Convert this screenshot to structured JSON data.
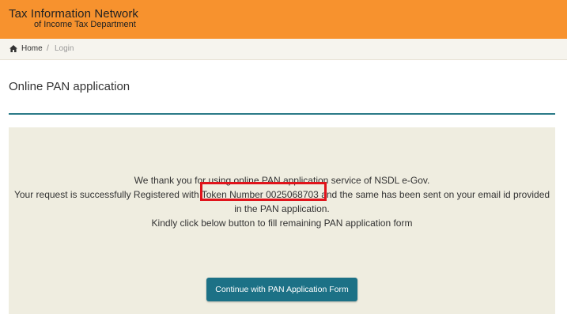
{
  "header": {
    "title": "Tax Information Network",
    "subtitle": "of Income Tax Department",
    "bg_color": "#f7922e"
  },
  "breadcrumb": {
    "home_icon": "home-icon",
    "home_label": "Home",
    "separator": "/",
    "current": "Login"
  },
  "page": {
    "title": "Online PAN application"
  },
  "message": {
    "line1": "We thank you for using online PAN application service of NSDL e-Gov.",
    "line2_prefix": "Your request is successfully Registered with ",
    "token_text": "Token Number 0025068703",
    "line2_suffix": " and the same has been sent on your email id provided",
    "line3": "in the PAN application.",
    "line4": "Kindly click below button to fill remaining PAN application form",
    "highlight_color": "#e0141b"
  },
  "actions": {
    "continue_label": "Continue with PAN Application Form",
    "button_color": "#1c7186"
  }
}
